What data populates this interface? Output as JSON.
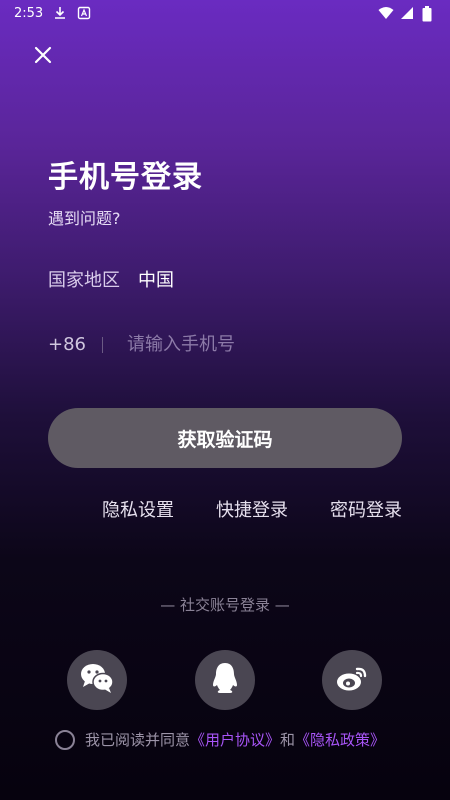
{
  "status_bar": {
    "time": "2:53",
    "icons": [
      "download-icon",
      "notification-a-icon",
      "wifi-icon",
      "signal-icon",
      "battery-icon"
    ]
  },
  "header": {
    "close_icon": "close-icon",
    "title": "手机号登录",
    "help_link": "遇到问题?"
  },
  "form": {
    "region_label": "国家地区",
    "region_value": "中国",
    "country_code": "+86",
    "phone_placeholder": "请输入手机号",
    "phone_value": "",
    "get_code_label": "获取验证码"
  },
  "options": {
    "privacy_settings": "隐私设置",
    "quick_login": "快捷登录",
    "password_login": "密码登录"
  },
  "social": {
    "title": "— 社交账号登录 —",
    "buttons": [
      {
        "name": "wechat-icon"
      },
      {
        "name": "qq-icon"
      },
      {
        "name": "weibo-icon"
      }
    ]
  },
  "agreement": {
    "prefix": "我已阅读并同意",
    "user_agreement": "《用户协议》",
    "and": "和",
    "privacy_policy": "《隐私政策》"
  },
  "colors": {
    "accent": "#a855f7",
    "button_bg": "#5f5a63",
    "bg_top": "#6a2bc1",
    "bg_bottom": "#06020e"
  }
}
